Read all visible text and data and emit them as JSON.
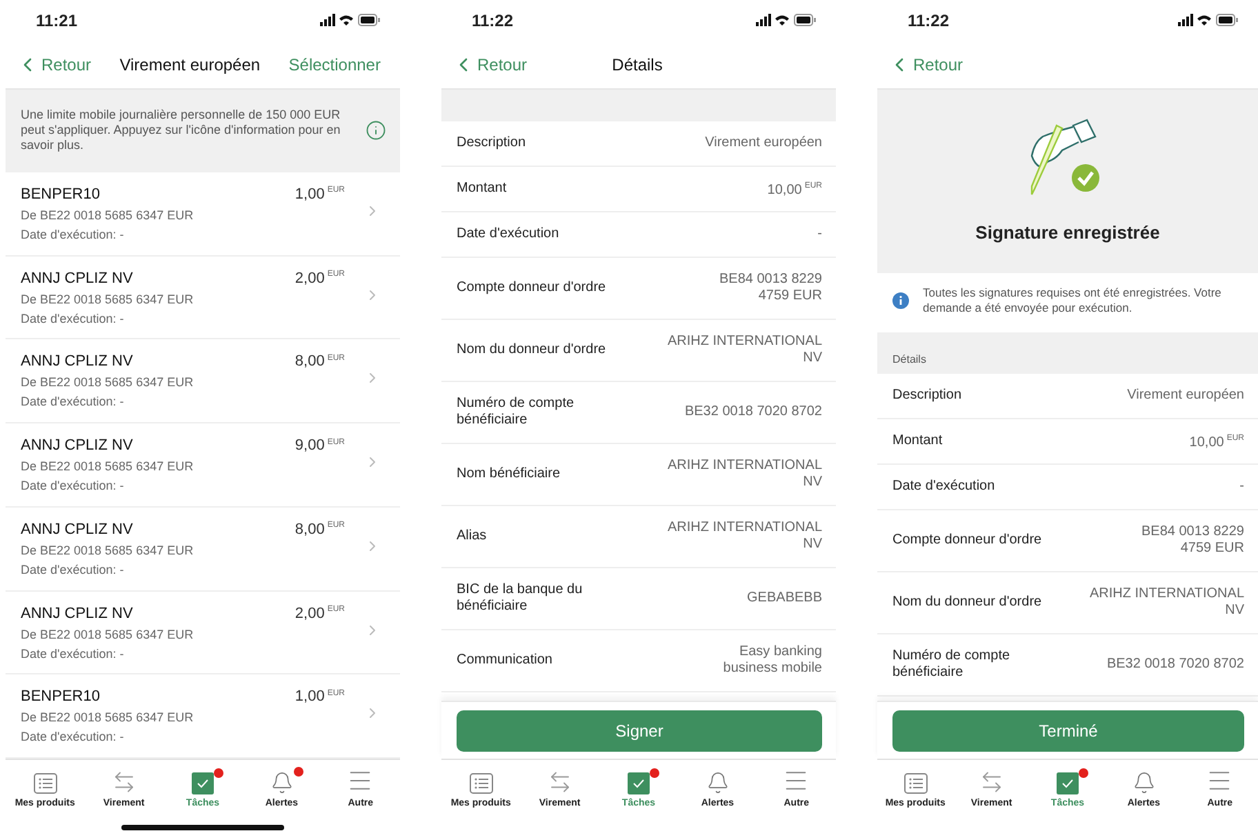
{
  "screens": [
    {
      "kind": "list",
      "time": "11:21",
      "nav": {
        "back": "Retour",
        "title": "Virement européen",
        "action": "Sélectionner"
      },
      "notice": "Une limite mobile journalière personnelle de 150 000 EUR peut s'appliquer. Appuyez sur l'icône d'information pour en savoir plus.",
      "transfers": [
        {
          "name": "BENPER10",
          "account": "De BE22 0018 5685 6347 EUR",
          "date": "Date d'exécution: -",
          "amount": "1,00",
          "currency": "EUR"
        },
        {
          "name": "ANNJ CPLIZ NV",
          "account": "De BE22 0018 5685 6347 EUR",
          "date": "Date d'exécution: -",
          "amount": "2,00",
          "currency": "EUR"
        },
        {
          "name": "ANNJ CPLIZ NV",
          "account": "De BE22 0018 5685 6347 EUR",
          "date": "Date d'exécution: -",
          "amount": "8,00",
          "currency": "EUR"
        },
        {
          "name": "ANNJ CPLIZ NV",
          "account": "De BE22 0018 5685 6347 EUR",
          "date": "Date d'exécution: -",
          "amount": "9,00",
          "currency": "EUR"
        },
        {
          "name": "ANNJ CPLIZ NV",
          "account": "De BE22 0018 5685 6347 EUR",
          "date": "Date d'exécution: -",
          "amount": "8,00",
          "currency": "EUR"
        },
        {
          "name": "ANNJ CPLIZ NV",
          "account": "De BE22 0018 5685 6347 EUR",
          "date": "Date d'exécution: -",
          "amount": "2,00",
          "currency": "EUR"
        },
        {
          "name": "BENPER10",
          "account": "De BE22 0018 5685 6347 EUR",
          "date": "Date d'exécution: -",
          "amount": "1,00",
          "currency": "EUR"
        }
      ],
      "tabs": [
        {
          "kind": "products",
          "label": "Mes produits",
          "selected": false,
          "badge": false
        },
        {
          "kind": "transfer",
          "label": "Virement",
          "selected": false,
          "badge": false
        },
        {
          "kind": "tasks",
          "label": "Tâches",
          "selected": true,
          "badge": true
        },
        {
          "kind": "alerts",
          "label": "Alertes",
          "selected": false,
          "badge": true
        },
        {
          "kind": "more",
          "label": "Autre",
          "selected": false,
          "badge": false
        }
      ]
    },
    {
      "kind": "details",
      "time": "11:22",
      "nav": {
        "back": "Retour",
        "title": "Détails"
      },
      "rows": [
        {
          "label": "Description",
          "value": "Virement européen"
        },
        {
          "label": "Montant",
          "value": "10,00",
          "currency": "EUR"
        },
        {
          "label": "Date d'exécution",
          "value": "-"
        },
        {
          "label": "Compte donneur d'ordre",
          "value": "BE84 0013 8229\n4759 EUR"
        },
        {
          "label": "Nom du donneur d'ordre",
          "value": "ARIHZ INTERNATIONAL\nNV"
        },
        {
          "label": "Numéro de compte\nbénéficiaire",
          "value": "BE32 0018 7020 8702"
        },
        {
          "label": "Nom bénéficiaire",
          "value": "ARIHZ INTERNATIONAL\nNV"
        },
        {
          "label": "Alias",
          "value": "ARIHZ INTERNATIONAL\nNV"
        },
        {
          "label": "BIC de la banque du\nbénéficiaire",
          "value": "GEBABEBB"
        },
        {
          "label": "Communication",
          "value": "Easy banking\nbusiness mobile"
        }
      ],
      "button": "Signer",
      "tabs": [
        {
          "kind": "products",
          "label": "Mes produits",
          "selected": false,
          "badge": false
        },
        {
          "kind": "transfer",
          "label": "Virement",
          "selected": false,
          "badge": false
        },
        {
          "kind": "tasks",
          "label": "Tâches",
          "selected": true,
          "badge": true
        },
        {
          "kind": "alerts",
          "label": "Alertes",
          "selected": false,
          "badge": false
        },
        {
          "kind": "more",
          "label": "Autre",
          "selected": false,
          "badge": false
        }
      ]
    },
    {
      "kind": "done",
      "time": "11:22",
      "nav": {
        "back": "Retour"
      },
      "heading": "Signature enregistrée",
      "message": "Toutes les signatures requises ont été enregistrées. Votre demande a été envoyée pour exécution.",
      "section": "Détails",
      "rows": [
        {
          "label": "Description",
          "value": "Virement européen"
        },
        {
          "label": "Montant",
          "value": "10,00",
          "currency": "EUR"
        },
        {
          "label": "Date d'exécution",
          "value": "-"
        },
        {
          "label": "Compte donneur d'ordre",
          "value": "BE84 0013 8229\n4759 EUR"
        },
        {
          "label": "Nom du donneur d'ordre",
          "value": "ARIHZ INTERNATIONAL\nNV"
        },
        {
          "label": "Numéro de compte\nbénéficiaire",
          "value": "BE32 0018 7020 8702"
        }
      ],
      "button": "Terminé",
      "tabs": [
        {
          "kind": "products",
          "label": "Mes produits",
          "selected": false,
          "badge": false
        },
        {
          "kind": "transfer",
          "label": "Virement",
          "selected": false,
          "badge": false
        },
        {
          "kind": "tasks",
          "label": "Tâches",
          "selected": true,
          "badge": true
        },
        {
          "kind": "alerts",
          "label": "Alertes",
          "selected": false,
          "badge": false
        },
        {
          "kind": "more",
          "label": "Autre",
          "selected": false,
          "badge": false
        }
      ]
    }
  ]
}
